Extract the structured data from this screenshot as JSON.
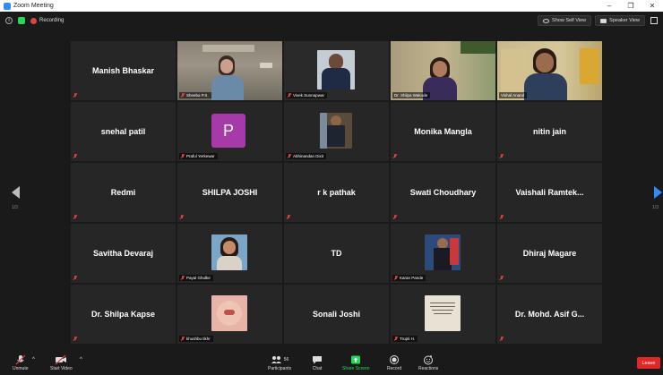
{
  "window": {
    "title": "Zoom Meeting",
    "controls": [
      "–",
      "❐",
      "✕"
    ]
  },
  "topbar": {
    "recording_label": "Recording",
    "show_self_view": "Show Self View",
    "speaker_view": "Speaker View"
  },
  "pagination": {
    "left": "1/3",
    "right": "1/3"
  },
  "participants": [
    {
      "name": "Manish Bhaskar",
      "mode": "name"
    },
    {
      "name": "Sheeba P.S.",
      "mode": "video"
    },
    {
      "name": "Vivek Sunnapwar",
      "mode": "video"
    },
    {
      "name": "Dr. Shilpa Wakode",
      "mode": "video"
    },
    {
      "name": "Vishal Anand",
      "mode": "video",
      "active": true
    },
    {
      "name": "snehal patil",
      "mode": "name"
    },
    {
      "name": "Praful Yerkewar",
      "mode": "avatar",
      "initial": "P"
    },
    {
      "name": "Abhinandan Dixit",
      "mode": "video"
    },
    {
      "name": "Monika Mangla",
      "mode": "name"
    },
    {
      "name": "nitin jain",
      "mode": "name"
    },
    {
      "name": "Redmi",
      "mode": "name"
    },
    {
      "name": "SHILPA JOSHI",
      "mode": "name"
    },
    {
      "name": "r k pathak",
      "mode": "name"
    },
    {
      "name": "Swati Choudhary",
      "mode": "name"
    },
    {
      "name": "Vaishali Ramtek...",
      "mode": "name"
    },
    {
      "name": "Savitha Devaraj",
      "mode": "name"
    },
    {
      "name": "Payal Ghulke",
      "mode": "video"
    },
    {
      "name": "TD",
      "mode": "name"
    },
    {
      "name": "Karan Pande",
      "mode": "video"
    },
    {
      "name": "Dhiraj Magare",
      "mode": "name"
    },
    {
      "name": "Dr. Shilpa Kapse",
      "mode": "name"
    },
    {
      "name": "khushbu tikhr",
      "mode": "video"
    },
    {
      "name": "Sonali Joshi",
      "mode": "name"
    },
    {
      "name": "Trupti H.",
      "mode": "video"
    },
    {
      "name": "Dr. Mohd. Asif G...",
      "mode": "name"
    }
  ],
  "toolbar": {
    "unmute": "Unmute",
    "start_video": "Start Video",
    "participants": "Participants",
    "participant_count": "56",
    "chat": "Chat",
    "share_screen": "Share Screen",
    "record": "Record",
    "reactions": "Reactions",
    "leave": "Leave"
  },
  "colors": {
    "accent": "#2d8cff",
    "share": "#23d959",
    "leave": "#e02828",
    "active_speaker": "#c8e64a"
  }
}
